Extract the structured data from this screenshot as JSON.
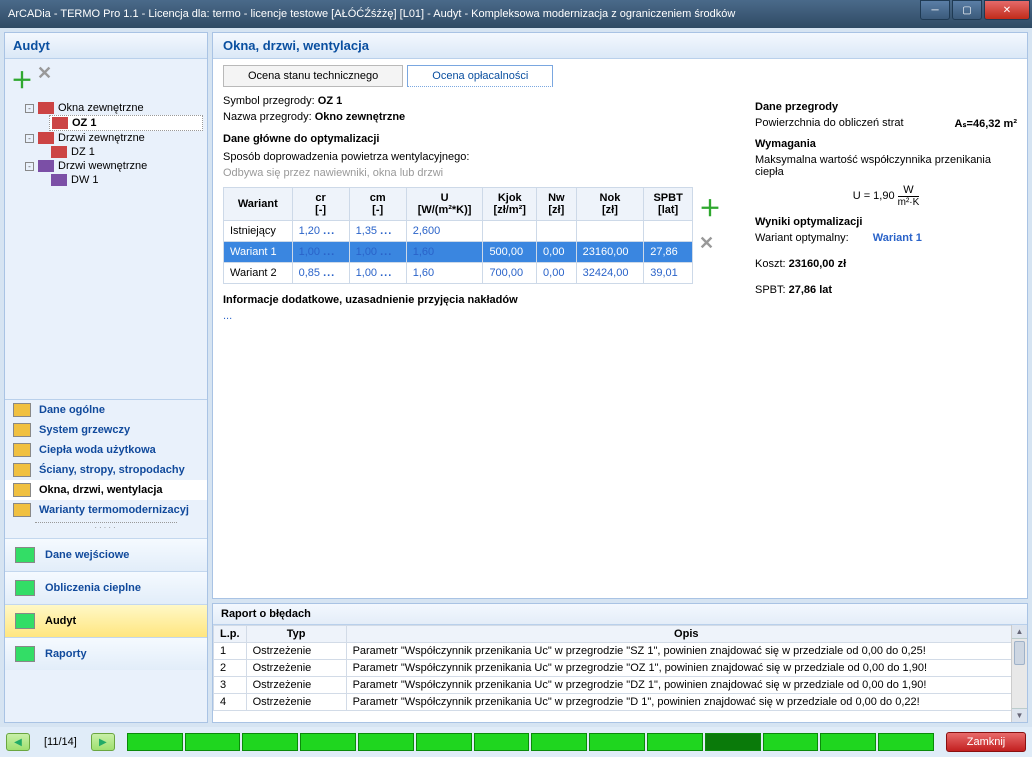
{
  "window": {
    "title": "ArCADia - TERMO Pro 1.1 - Licencja dla: termo - licencje testowe [AŁÓĆŹśźżę] [L01] - Audyt - Kompleksowa modernizacja z ograniczeniem środków"
  },
  "sidebar": {
    "title": "Audyt",
    "tree": [
      {
        "label": "Okna zewnętrzne",
        "children": [
          {
            "label": "OZ 1",
            "selected": true
          }
        ]
      },
      {
        "label": "Drzwi zewnętrzne",
        "children": [
          {
            "label": "DZ 1"
          }
        ]
      },
      {
        "label": "Drzwi wewnętrzne",
        "children": [
          {
            "label": "DW 1"
          }
        ]
      }
    ],
    "tools": [
      {
        "label": "Dane ogólne"
      },
      {
        "label": "System grzewczy"
      },
      {
        "label": "Ciepła woda użytkowa"
      },
      {
        "label": "Ściany, stropy, stropodachy"
      },
      {
        "label": "Okna, drzwi, wentylacja",
        "active": true
      },
      {
        "label": "Warianty termomodernizacyj"
      }
    ],
    "nav": [
      {
        "label": "Dane wejściowe"
      },
      {
        "label": "Obliczenia cieplne"
      },
      {
        "label": "Audyt",
        "highlight": true
      },
      {
        "label": "Raporty"
      }
    ]
  },
  "main": {
    "title": "Okna, drzwi, wentylacja",
    "tabs": [
      {
        "label": "Ocena stanu technicznego"
      },
      {
        "label": "Ocena opłacalności",
        "active": true
      }
    ],
    "symbol_k": "Symbol przegrody:",
    "symbol_v": "OZ 1",
    "nazwa_k": "Nazwa przegrody:",
    "nazwa_v": "Okno zewnętrzne",
    "section1": "Dane główne do optymalizacji",
    "sposob": "Sposób doprowadzenia powietrza wentylacyjnego:",
    "hint": "Odbywa się przez nawiewniki, okna lub drzwi",
    "table": {
      "headers": [
        "Wariant",
        "cr\n[-]",
        "cm\n[-]",
        "U\n[W/(m²*K)]",
        "Kjok\n[zł/m²]",
        "Nw\n[zł]",
        "Nok\n[zł]",
        "SPBT\n[lat]"
      ],
      "rows": [
        {
          "c": [
            "Istniejący",
            "1,20",
            "1,35",
            "2,600",
            "",
            "",
            "",
            ""
          ],
          "sel": false,
          "white": true
        },
        {
          "c": [
            "Wariant 1",
            "1,00",
            "1,00",
            "1,60",
            "500,00",
            "0,00",
            "23160,00",
            "27,86"
          ],
          "sel": true
        },
        {
          "c": [
            "Wariant 2",
            "0,85",
            "1,00",
            "1,60",
            "700,00",
            "0,00",
            "32424,00",
            "39,01"
          ],
          "sel": false,
          "white": true
        }
      ]
    },
    "extra_h": "Informacje dodatkowe, uzasadnienie przyjęcia nakładów",
    "extra_dots": "..."
  },
  "props": {
    "h1": "Dane przegrody",
    "pow_k": "Powierzchnia do obliczeń strat",
    "pow_v": "Aₛ=46,32 m²",
    "h2": "Wymagania",
    "maks": "Maksymalna wartość współczynnika przenikania ciepła",
    "formula": "U = 1,90 W/m²·K",
    "h3": "Wyniki optymalizacji",
    "wopt_k": "Wariant optymalny:",
    "wopt_v": "Wariant 1",
    "koszt_k": "Koszt:",
    "koszt_v": "23160,00 zł",
    "spbt_k": "SPBT:",
    "spbt_v": "27,86  lat"
  },
  "errors": {
    "title": "Raport o błędach",
    "headers": [
      "L.p.",
      "Typ",
      "Opis"
    ],
    "rows": [
      {
        "n": "1",
        "t": "Ostrzeżenie",
        "o": "Parametr \"Współczynnik przenikania Uc\" w przegrodzie \"SZ 1\", powinien znajdować się w przedziale od 0,00 do 0,25!"
      },
      {
        "n": "2",
        "t": "Ostrzeżenie",
        "o": "Parametr \"Współczynnik przenikania Uc\" w przegrodzie \"OZ 1\", powinien znajdować się w przedziale od 0,00 do 1,90!"
      },
      {
        "n": "3",
        "t": "Ostrzeżenie",
        "o": "Parametr \"Współczynnik przenikania Uc\" w przegrodzie \"DZ 1\", powinien znajdować się w przedziale od 0,00 do 1,90!"
      },
      {
        "n": "4",
        "t": "Ostrzeżenie",
        "o": "Parametr \"Współczynnik przenikania Uc\" w przegrodzie \"D 1\", powinien znajdować się w przedziale od 0,00 do 0,22!"
      }
    ]
  },
  "footer": {
    "page": "[11/14]",
    "close": "Zamknij"
  }
}
